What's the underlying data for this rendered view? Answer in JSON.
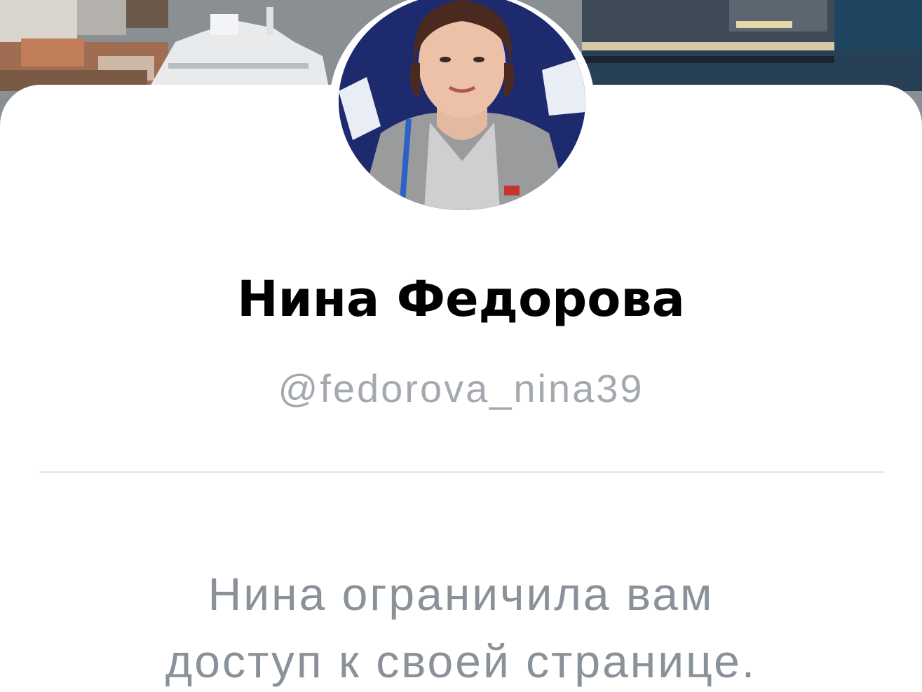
{
  "profile": {
    "name": "Нина Федорова",
    "handle": "@fedorova_nina39",
    "restricted_line1": "Нина ограничила вам",
    "restricted_line2": "доступ к своей странице."
  },
  "colors": {
    "name_text": "#000000",
    "handle_text": "#a4a9af",
    "restricted_text": "#8a9198",
    "divider": "#e3e5e8",
    "card_background": "#ffffff"
  },
  "icons": {
    "cover": "cover-photo-harbor",
    "avatar": "profile-photo"
  }
}
